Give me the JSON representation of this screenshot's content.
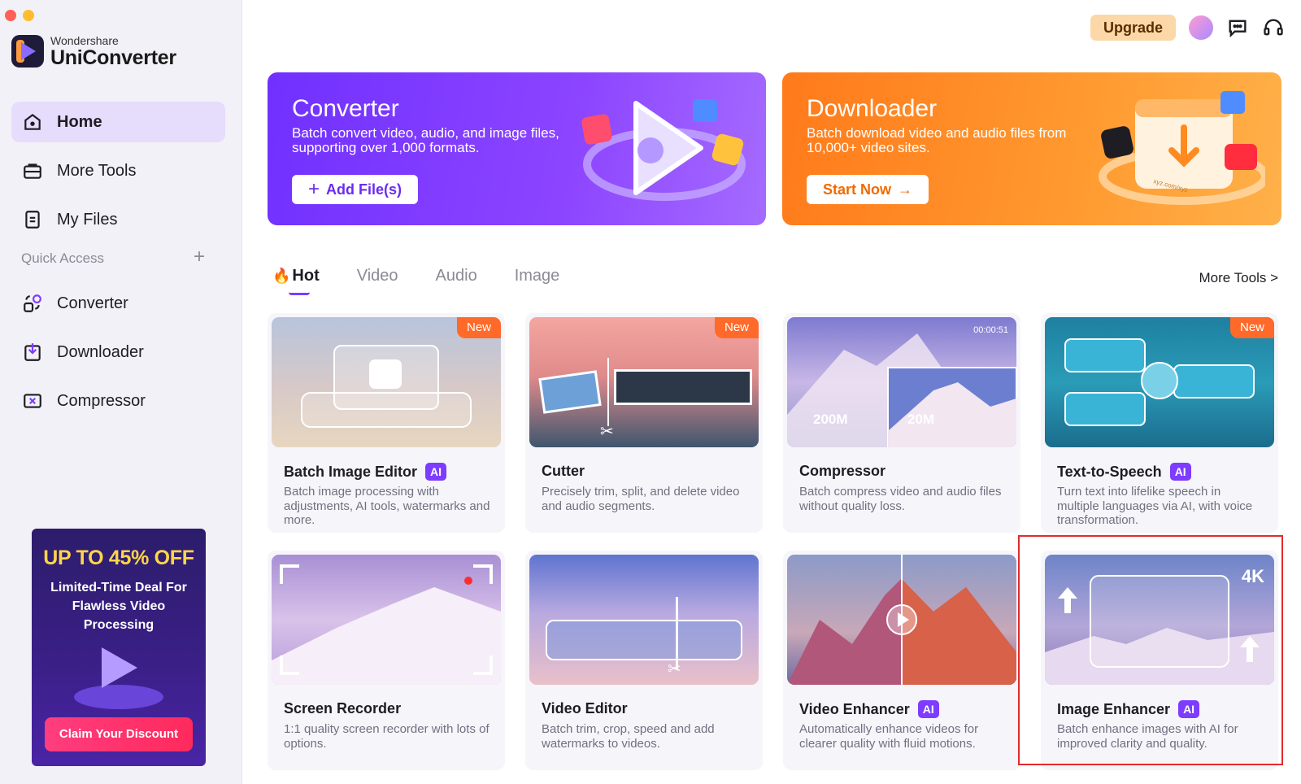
{
  "app": {
    "brand_sub": "Wondershare",
    "brand_main": "UniConverter"
  },
  "sidebar": {
    "items": [
      {
        "label": "Home",
        "icon": "home-icon"
      },
      {
        "label": "More Tools",
        "icon": "toolbox-icon"
      },
      {
        "label": "My Files",
        "icon": "file-icon"
      }
    ],
    "quick_access_title": "Quick Access",
    "quick_access_plus": "+",
    "quick_items": [
      {
        "label": "Converter",
        "icon": "converter-icon"
      },
      {
        "label": "Downloader",
        "icon": "download-icon"
      },
      {
        "label": "Compressor",
        "icon": "compress-icon"
      }
    ]
  },
  "promo": {
    "title": "UP TO 45% OFF",
    "subtitle": "Limited-Time Deal For Flawless Video Processing",
    "button": "Claim Your Discount"
  },
  "topbar": {
    "upgrade": "Upgrade"
  },
  "hero": {
    "converter": {
      "title": "Converter",
      "desc": "Batch convert video, audio, and image files, supporting over 1,000 formats.",
      "button": "Add File(s)",
      "button_icon": "+"
    },
    "downloader": {
      "title": "Downloader",
      "desc": "Batch download video and audio files from 10,000+ video sites.",
      "button": "Start Now",
      "button_icon": "→",
      "art_label": "xyz.com/xyz"
    }
  },
  "tabs": {
    "items": [
      "Hot",
      "Video",
      "Audio",
      "Image"
    ],
    "more": "More Tools >"
  },
  "cards": [
    {
      "name": "Batch Image Editor",
      "ai": true,
      "badge": "New",
      "desc": "Batch image processing with adjustments, AI tools, watermarks and more."
    },
    {
      "name": "Cutter",
      "ai": false,
      "badge": "New",
      "desc": "Precisely trim, split, and delete video and audio segments."
    },
    {
      "name": "Compressor",
      "ai": false,
      "badge": "",
      "desc": "Batch compress video and audio files without quality loss.",
      "thumb": {
        "time": "00:00:51",
        "from": "200M",
        "to": "20M"
      }
    },
    {
      "name": "Text-to-Speech",
      "ai": true,
      "badge": "New",
      "desc": "Turn text into lifelike speech in multiple languages via AI, with voice transformation."
    },
    {
      "name": "Screen Recorder",
      "ai": false,
      "badge": "",
      "desc": "1:1 quality screen recorder with lots of options."
    },
    {
      "name": "Video Editor",
      "ai": false,
      "badge": "",
      "desc": "Batch trim, crop, speed and add watermarks to videos."
    },
    {
      "name": "Video Enhancer",
      "ai": true,
      "badge": "",
      "desc": "Automatically enhance videos for clearer quality with fluid motions."
    },
    {
      "name": "Image Enhancer",
      "ai": true,
      "badge": "",
      "desc": "Batch enhance images with AI for improved clarity and quality.",
      "thumb": {
        "label": "4K"
      }
    }
  ],
  "ai_label": "AI",
  "colors": {
    "accent": "#7d3cff",
    "converter_banner": "#7030ff",
    "downloader_banner": "#ff7a1a",
    "new_badge": "#ff6a2a",
    "highlight": "#e32b2b"
  }
}
